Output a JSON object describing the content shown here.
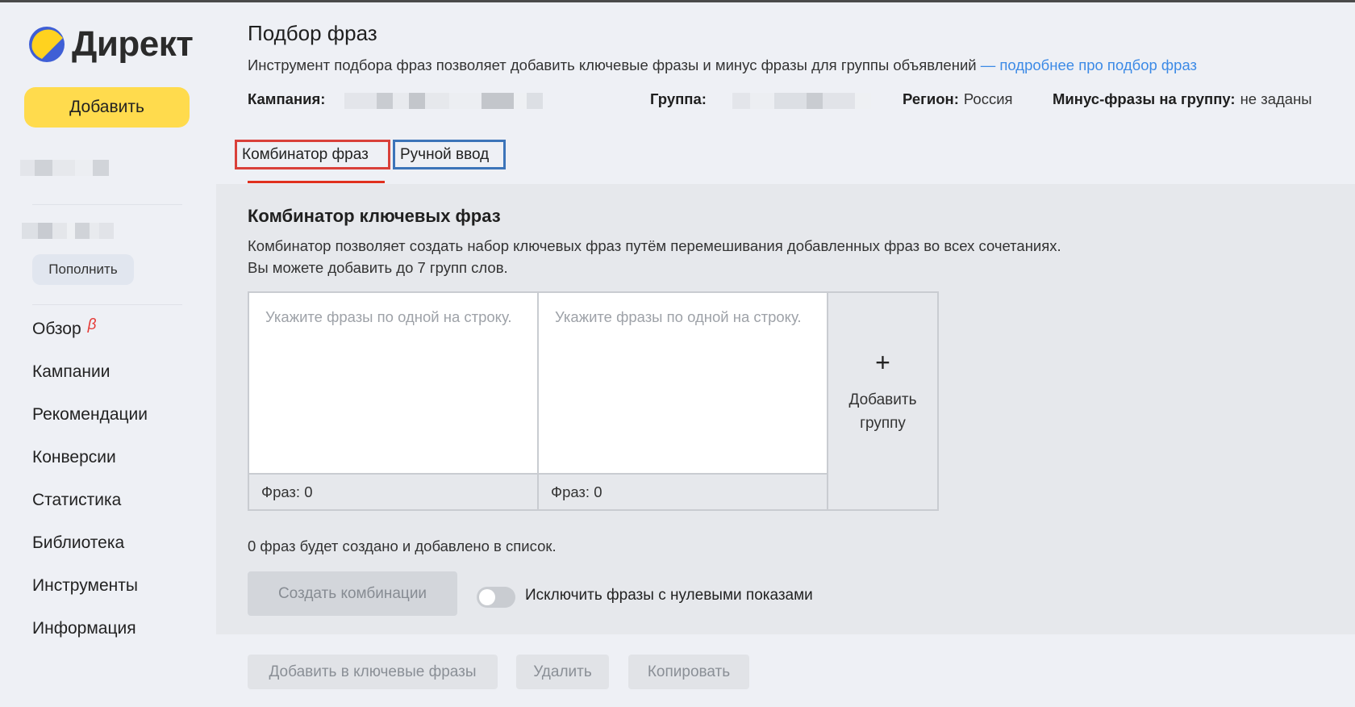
{
  "brand": {
    "name": "Директ"
  },
  "sidebar": {
    "add_button": "Добавить",
    "topup_button": "Пополнить",
    "nav": [
      {
        "label": "Обзор",
        "badge": "β"
      },
      {
        "label": "Кампании"
      },
      {
        "label": "Рекомендации"
      },
      {
        "label": "Конверсии"
      },
      {
        "label": "Статистика"
      },
      {
        "label": "Библиотека"
      },
      {
        "label": "Инструменты"
      },
      {
        "label": "Информация"
      }
    ]
  },
  "header": {
    "title": "Подбор фраз",
    "description": "Инструмент подбора фраз позволяет добавить ключевые фразы и минус фразы для группы объявлений",
    "link": "— подробнее про подбор фраз",
    "campaign_label": "Кампания:",
    "group_label": "Группа:",
    "region_label": "Регион:",
    "region_value": "Россия",
    "minus_label": "Минус-фразы на группу:",
    "minus_value": "не заданы"
  },
  "tabs": [
    {
      "label": "Комбинатор фраз",
      "active": true
    },
    {
      "label": "Ручной ввод",
      "active": false
    }
  ],
  "combinator": {
    "title": "Комбинатор ключевых фраз",
    "description_line1": "Комбинатор позволяет создать набор ключевых фраз путём перемешивания добавленных фраз во всех сочетаниях.",
    "description_line2": "Вы можете добавить до 7 групп слов.",
    "groups": [
      {
        "placeholder": "Укажите фразы по одной на строку.",
        "count_label": "Фраз: 0"
      },
      {
        "placeholder": "Укажите фразы по одной на строку.",
        "count_label": "Фраз: 0"
      }
    ],
    "add_group_plus": "+",
    "add_group_label": "Добавить группу",
    "summary": "0 фраз будет создано и добавлено в список.",
    "create_button": "Создать комбинации",
    "exclude_toggle_label": "Исключить фразы с нулевыми показами"
  },
  "footer": {
    "add_to_keywords": "Добавить в ключевые фразы",
    "delete": "Удалить",
    "copy": "Копировать"
  },
  "colors": {
    "accent_yellow": "#ffdb4d",
    "link_blue": "#3c8ae6",
    "active_tab_outline": "#d9403a",
    "second_tab_outline": "#3c74b9",
    "beta_red": "#e53935"
  },
  "icons": {
    "logo": "yandex-direct-logo-icon"
  }
}
